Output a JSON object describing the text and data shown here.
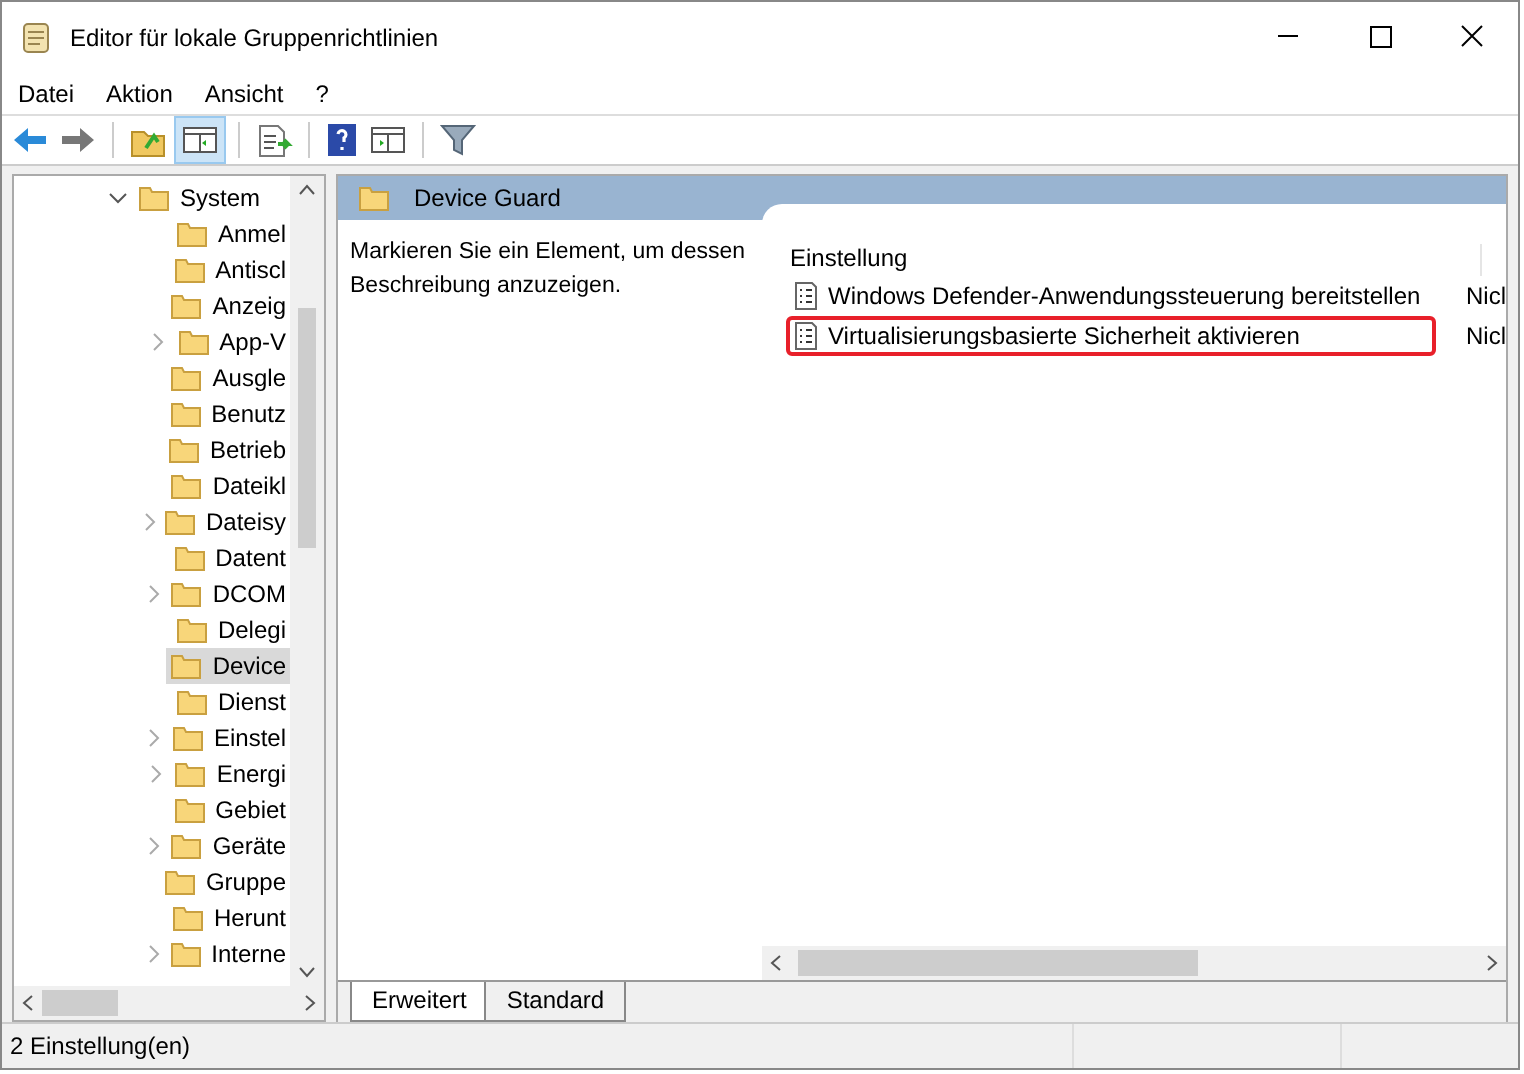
{
  "window": {
    "title": "Editor für lokale Gruppenrichtlinien"
  },
  "menu": [
    "Datei",
    "Aktion",
    "Ansicht",
    "?"
  ],
  "tree": [
    {
      "label": "System",
      "expanded": true,
      "children": [
        {
          "label": "Anmel",
          "expandable": false,
          "selected": false
        },
        {
          "label": "Antiscl",
          "expandable": false,
          "selected": false
        },
        {
          "label": "Anzeig",
          "expandable": false,
          "selected": false
        },
        {
          "label": "App-V",
          "expandable": true,
          "selected": false
        },
        {
          "label": "Ausgle",
          "expandable": false,
          "selected": false
        },
        {
          "label": "Benutz",
          "expandable": false,
          "selected": false
        },
        {
          "label": "Betrieb",
          "expandable": false,
          "selected": false
        },
        {
          "label": "Dateikl",
          "expandable": false,
          "selected": false
        },
        {
          "label": "Dateisy",
          "expandable": true,
          "selected": false
        },
        {
          "label": "Datent",
          "expandable": false,
          "selected": false
        },
        {
          "label": "DCOM",
          "expandable": true,
          "selected": false
        },
        {
          "label": "Delegi",
          "expandable": false,
          "selected": false
        },
        {
          "label": "Device",
          "expandable": false,
          "selected": true
        },
        {
          "label": "Dienst",
          "expandable": false,
          "selected": false
        },
        {
          "label": "Einstel",
          "expandable": true,
          "selected": false
        },
        {
          "label": "Energi",
          "expandable": true,
          "selected": false
        },
        {
          "label": "Gebiet",
          "expandable": false,
          "selected": false
        },
        {
          "label": "Geräte",
          "expandable": true,
          "selected": false
        },
        {
          "label": "Gruppe",
          "expandable": false,
          "selected": false
        },
        {
          "label": "Herunt",
          "expandable": false,
          "selected": false
        },
        {
          "label": "Interne",
          "expandable": true,
          "selected": false
        }
      ]
    }
  ],
  "pane": {
    "title": "Device Guard",
    "description": "Markieren Sie ein Element, um dessen Beschreibung anzuzeigen.",
    "columns": [
      "Einstellung"
    ],
    "rows": [
      {
        "name": "Windows Defender-Anwendungssteuerung bereitstellen",
        "state": "Nicl",
        "highlighted": false
      },
      {
        "name": "Virtualisierungsbasierte Sicherheit aktivieren",
        "state": "Nicl",
        "highlighted": true
      }
    ]
  },
  "tabs": [
    {
      "label": "Erweitert",
      "selected": true
    },
    {
      "label": "Standard",
      "selected": false
    }
  ],
  "status_bar": "2 Einstellung(en)"
}
